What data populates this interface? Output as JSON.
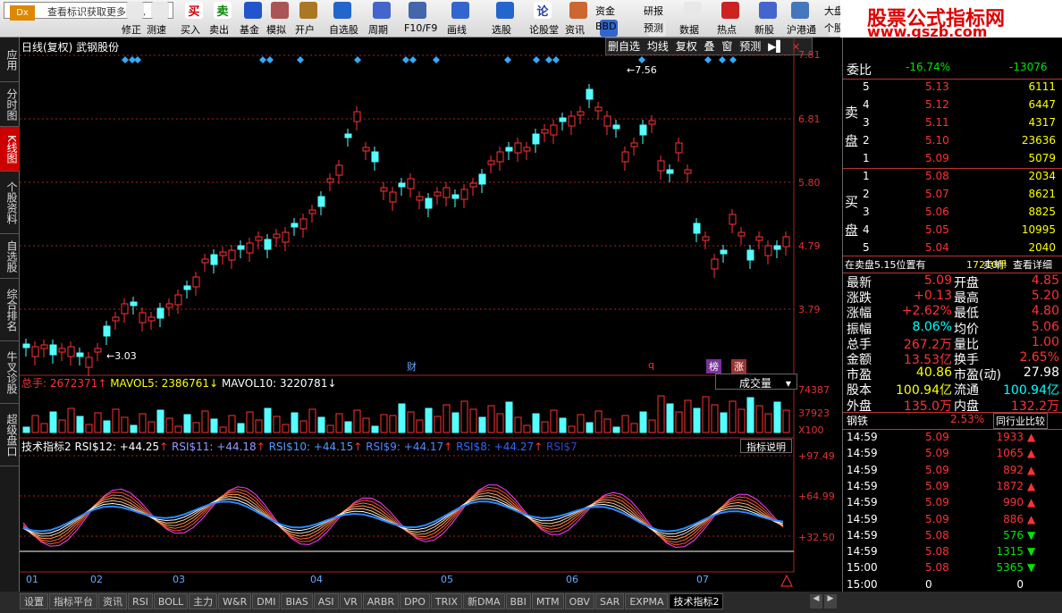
{
  "toolbar": {
    "search_placeholder": "查看标识获取更多信息",
    "logo": "Dx",
    "buttons": [
      {
        "label": "修正",
        "color": "#e8e8e8"
      },
      {
        "label": "测速",
        "color": "#e8e8e8"
      },
      {
        "label": "买入",
        "color": "#c00",
        "glyph": "买"
      },
      {
        "label": "卖出",
        "color": "#080",
        "glyph": "卖"
      },
      {
        "label": "基金",
        "color": "#2255cc"
      },
      {
        "label": "模拟",
        "color": "#a55"
      },
      {
        "label": "开户",
        "color": "#aa7722"
      },
      {
        "label": "自选股",
        "color": "#2266cc"
      },
      {
        "label": "周期",
        "color": "#4466cc"
      },
      {
        "label": "F10/F9",
        "color": "#4466aa"
      },
      {
        "label": "画线",
        "color": "#3366cc"
      },
      {
        "label": "选股",
        "color": "#2266cc"
      },
      {
        "label": "论股堂",
        "color": "#2244aa",
        "glyph": "论"
      },
      {
        "label": "资讯",
        "color": "#cc6633"
      },
      {
        "label": "资金",
        "glyph": "资金",
        "color": "#e8e8e8"
      },
      {
        "label": "BBD",
        "color": "#3366cc"
      },
      {
        "label": "研报",
        "color": "#e8e8e8"
      },
      {
        "label": "预测",
        "color": "#e8e8e8"
      },
      {
        "label": "数据",
        "color": "#e8e8e8"
      },
      {
        "label": "热点",
        "color": "#c22"
      },
      {
        "label": "新股",
        "color": "#4466cc"
      },
      {
        "label": "沪港通",
        "color": "#4477bb"
      },
      {
        "label": "大盘",
        "color": "#e8e8e8"
      },
      {
        "label": "个股",
        "color": "#e8e8e8"
      }
    ]
  },
  "ad": {
    "line1": "股票公式指标网",
    "line2": "www.gszb.com"
  },
  "left_nav": [
    "应用",
    "分时图",
    "K线图",
    "个股资料",
    "自选股",
    "综合排名",
    "牛叉诊股",
    "超级盘口"
  ],
  "chart": {
    "header": "日线(复权) 武钢股份",
    "tools": [
      "删自选",
      "均线",
      "复权",
      "叠",
      "窗",
      "预测"
    ],
    "high_label": "7.56",
    "low_label": "3.03",
    "yaxis": [
      "7.81",
      "6.81",
      "5.80",
      "4.79",
      "3.79"
    ],
    "events": {
      "cai": "财",
      "q": "q",
      "bang": "榜",
      "zhang": "涨"
    },
    "vol_header": {
      "total": "总手: 2672371",
      "ma5": "MAVOL5: 2386761",
      "ma10": "MAVOL10: 3220781",
      "vol_label": "成交量"
    },
    "vol_axis": [
      "74387",
      "37923",
      "X100"
    ],
    "rsi_header": {
      "name": "技术指标2",
      "r12": "RSI$12: +44.25",
      "r11": "RSI$11: +44.18",
      "r10": "RSI$10: +44.15",
      "r9": "RSI$9: +44.17",
      "r8": "RSI$8: +44.27",
      "r7": "RSI$7",
      "explain": "指标说明"
    },
    "rsi_axis": [
      "+97.49",
      "+64.99",
      "+32.50"
    ],
    "months": [
      "01",
      "02",
      "03",
      "04",
      "05",
      "06",
      "07"
    ]
  },
  "bottom_tabs": [
    "设置",
    "指标平台",
    "资讯",
    "RSI",
    "BOLL",
    "主力",
    "W&R",
    "DMI",
    "BIAS",
    "ASI",
    "VR",
    "ARBR",
    "DPO",
    "TRIX",
    "新DMA",
    "BBI",
    "MTM",
    "OBV",
    "SAR",
    "EXPMA",
    "技术指标2"
  ],
  "right": {
    "wb": {
      "label": "委比",
      "pct": "-16.74%",
      "diff": "-13076"
    },
    "sell": [
      [
        "5",
        "5.13",
        "6111"
      ],
      [
        "4",
        "5.12",
        "6447"
      ],
      [
        "3",
        "5.11",
        "4317"
      ],
      [
        "2",
        "5.10",
        "23636"
      ],
      [
        "1",
        "5.09",
        "5079"
      ]
    ],
    "buy": [
      [
        "1",
        "5.08",
        "2034"
      ],
      [
        "2",
        "5.07",
        "8621"
      ],
      [
        "3",
        "5.06",
        "8825"
      ],
      [
        "4",
        "5.05",
        "10995"
      ],
      [
        "5",
        "5.04",
        "2040"
      ]
    ],
    "sell_label": "卖盘",
    "buy_label": "买盘",
    "notice": {
      "a": "在卖盘5.15位置有",
      "b": "17210手",
      "c": "卖单!",
      "d": "查看详细"
    },
    "quote": [
      [
        "最新",
        "5.09",
        "开盘",
        "4.85"
      ],
      [
        "涨跌",
        "+0.13",
        "最高",
        "5.20"
      ],
      [
        "涨幅",
        "+2.62%",
        "最低",
        "4.80"
      ],
      [
        "振幅",
        "8.06%",
        "均价",
        "5.06"
      ],
      [
        "总手",
        "267.2万",
        "量比",
        "1.00"
      ],
      [
        "金额",
        "13.53亿",
        "换手",
        "2.65%"
      ],
      [
        "市盈",
        "40.86",
        "市盈(动)",
        "27.98"
      ],
      [
        "股本",
        "100.94亿",
        "流通",
        "100.94亿"
      ],
      [
        "外盘",
        "135.0万",
        "内盘",
        "132.2万"
      ]
    ],
    "industry": {
      "name": "钢铁",
      "pct": "2.53%",
      "compare": "同行业比较"
    },
    "ticks": [
      [
        "14:59",
        "5.09",
        "1933",
        "up"
      ],
      [
        "14:59",
        "5.09",
        "1065",
        "up"
      ],
      [
        "14:59",
        "5.09",
        "892",
        "up"
      ],
      [
        "14:59",
        "5.09",
        "1872",
        "up"
      ],
      [
        "14:59",
        "5.09",
        "990",
        "up"
      ],
      [
        "14:59",
        "5.09",
        "886",
        "up"
      ],
      [
        "14:59",
        "5.08",
        "576",
        "down"
      ],
      [
        "14:59",
        "5.08",
        "1315",
        "down"
      ],
      [
        "15:00",
        "5.08",
        "5365",
        "down"
      ],
      [
        "15:00",
        "0",
        "0",
        ""
      ]
    ],
    "tabs": [
      "细",
      "诊",
      "分",
      "筹",
      "焰",
      "指",
      "财"
    ]
  },
  "colors": {
    "up": "#ff3232",
    "down": "#54ffff",
    "bg": "#000"
  }
}
